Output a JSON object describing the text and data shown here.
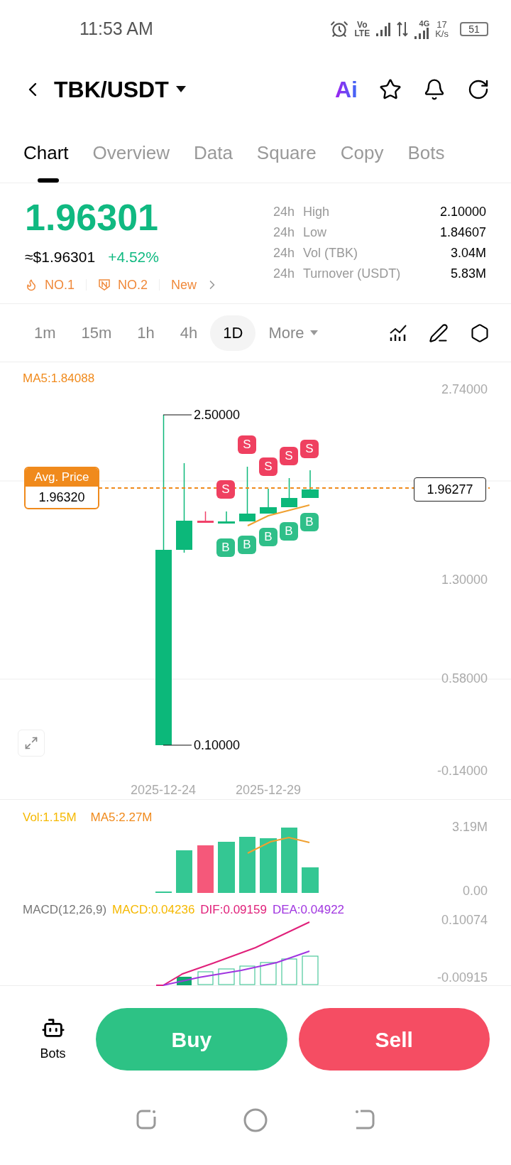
{
  "status_bar": {
    "time": "11:53 AM",
    "volte_top": "Vo",
    "volte_bottom": "LTE",
    "network": "4G",
    "speed_value": "17",
    "speed_unit": "K/s",
    "battery": "51"
  },
  "header": {
    "pair": "TBK/USDT",
    "ai_label": "Ai"
  },
  "tabs": [
    {
      "label": "Chart",
      "selected": true
    },
    {
      "label": "Overview",
      "selected": false
    },
    {
      "label": "Data",
      "selected": false
    },
    {
      "label": "Square",
      "selected": false
    },
    {
      "label": "Copy",
      "selected": false
    },
    {
      "label": "Bots",
      "selected": false
    }
  ],
  "price": {
    "last": "1.96301",
    "usd": "≈$1.96301",
    "change": "+4.52%",
    "tags": [
      {
        "kind": "fire",
        "label": "NO.1"
      },
      {
        "kind": "badge",
        "label": "NO.2"
      },
      {
        "kind": "link",
        "label": "New"
      }
    ]
  },
  "stats": [
    {
      "period": "24h",
      "label": "High",
      "value": "2.10000"
    },
    {
      "period": "24h",
      "label": "Low",
      "value": "1.84607"
    },
    {
      "period": "24h",
      "label": "Vol (TBK)",
      "value": "3.04M"
    },
    {
      "period": "24h",
      "label": "Turnover (USDT)",
      "value": "5.83M"
    }
  ],
  "timeframes": [
    {
      "label": "1m",
      "selected": false
    },
    {
      "label": "15m",
      "selected": false
    },
    {
      "label": "1h",
      "selected": false
    },
    {
      "label": "4h",
      "selected": false
    },
    {
      "label": "1D",
      "selected": true
    },
    {
      "label": "More",
      "selected": false
    }
  ],
  "chart": {
    "ma_label": "MA5:1.84088",
    "y_labels": [
      "2.74000",
      "1.30000",
      "0.58000",
      "-0.14000"
    ],
    "high_label": "2.50000",
    "low_label": "0.10000",
    "avg_title": "Avg. Price",
    "avg_value": "1.96320",
    "current_price": "1.96277",
    "sell_markers": [
      "S",
      "S",
      "S",
      "S",
      "S"
    ],
    "buy_markers": [
      "B",
      "B",
      "B",
      "B",
      "B"
    ],
    "dates": [
      "2025-12-24",
      "2025-12-29"
    ]
  },
  "volume": {
    "vol_label": "Vol:1.15M",
    "ma_label": "MA5:2.27M",
    "y_labels": [
      "3.19M",
      "0.00"
    ]
  },
  "macd": {
    "title": "MACD(12,26,9)",
    "macd": "MACD:0.04236",
    "dif": "DIF:0.09159",
    "dea": "DEA:0.04922",
    "y_labels": [
      "0.10074",
      "-0.00915"
    ]
  },
  "bottom_bar": {
    "bots_label": "Bots",
    "buy": "Buy",
    "sell": "Sell"
  }
}
